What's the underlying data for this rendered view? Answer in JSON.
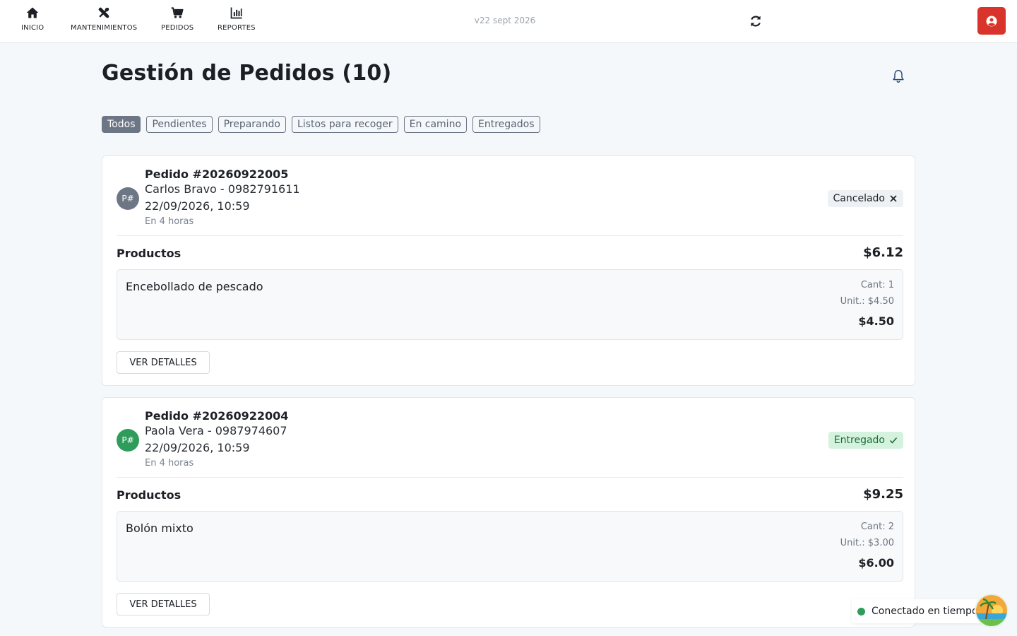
{
  "nav": {
    "items": [
      {
        "label": "INICIO",
        "icon": "home-icon"
      },
      {
        "label": "MANTENIMIENTOS",
        "icon": "tools-icon"
      },
      {
        "label": "PEDIDOS",
        "icon": "cart-icon"
      },
      {
        "label": "REPORTES",
        "icon": "chart-icon"
      }
    ],
    "version": "v22 sept 2026",
    "user_color": "#d9342b"
  },
  "page": {
    "title": "Gestión de Pedidos (10)"
  },
  "filters": [
    "Todos",
    "Pendientes",
    "Preparando",
    "Listos para recoger",
    "En camino",
    "Entregados"
  ],
  "orders": [
    {
      "avatar": "P#",
      "avatar_color": "#6d7684",
      "id": "Pedido #20260922005",
      "customer": "Carlos Bravo - 0982791611",
      "datetime": "22/09/2026, 10:59",
      "relative": "En 4 horas",
      "status": "Cancelado",
      "products_label": "Productos",
      "total": "$6.12",
      "item": {
        "name": "Encebollado de pescado",
        "qty": "Cant: 1",
        "unit": "Unit.: $4.50",
        "subtotal": "$4.50"
      },
      "details_label": "VER DETALLES"
    },
    {
      "avatar": "P#",
      "avatar_color": "#2e9c5b",
      "id": "Pedido #20260922004",
      "customer": "Paola Vera - 0987974607",
      "datetime": "22/09/2026, 10:59",
      "relative": "En 4 horas",
      "status": "Entregado",
      "products_label": "Productos",
      "total": "$9.25",
      "item": {
        "name": "Bolón mixto",
        "qty": "Cant: 2",
        "unit": "Unit.: $3.00",
        "subtotal": "$6.00"
      },
      "details_label": "VER DETALLES"
    }
  ],
  "connection": {
    "text": "Conectado en tiempo real",
    "color": "#2e9c5b"
  }
}
